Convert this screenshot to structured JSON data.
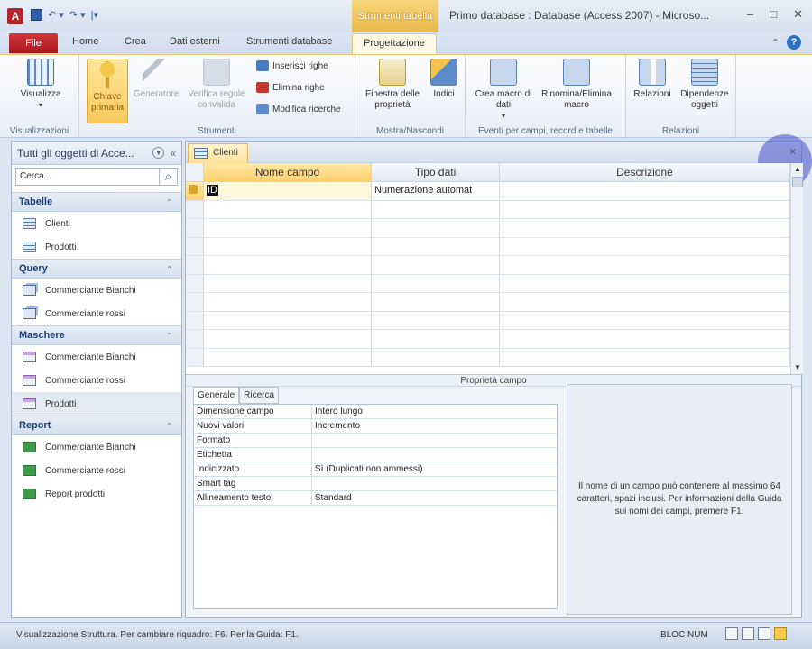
{
  "titlebar": {
    "app_icon": "A",
    "context_tab_header": "Strumenti tabella",
    "window_title": "Primo database : Database (Access 2007) - Microso...",
    "minimize": "–",
    "maximize": "□",
    "close": "✕"
  },
  "tabs": {
    "file": "File",
    "home": "Home",
    "crea": "Crea",
    "dati_esterni": "Dati esterni",
    "strumenti_database": "Strumenti database",
    "progettazione": "Progettazione"
  },
  "ribbon": {
    "visualizza": "Visualizza",
    "chiave_primaria": "Chiave primaria",
    "generatore": "Generatore",
    "verifica_regole": "Verifica regole convalida",
    "inserisci_righe": "Inserisci righe",
    "elimina_righe": "Elimina righe",
    "modifica_ricerche": "Modifica ricerche",
    "finestra_proprieta": "Finestra delle proprietà",
    "indici": "Indici",
    "crea_macro": "Crea macro di dati",
    "rinomina_macro": "Rinomina/Elimina macro",
    "relazioni": "Relazioni",
    "dipendenze": "Dipendenze oggetti",
    "group_visualizzazioni": "Visualizzazioni",
    "group_strumenti": "Strumenti",
    "group_mostra": "Mostra/Nascondi",
    "group_eventi": "Eventi per campi, record e tabelle",
    "group_relazioni": "Relazioni"
  },
  "nav": {
    "title": "Tutti gli oggetti di Acce...",
    "search_placeholder": "Cerca...",
    "sections": [
      {
        "label": "Tabelle",
        "items": [
          "Clienti",
          "Prodotti"
        ]
      },
      {
        "label": "Query",
        "items": [
          "Commerciante Bianchi",
          "Commerciante rossi"
        ]
      },
      {
        "label": "Maschere",
        "items": [
          "Commerciante Bianchi",
          "Commerciante rossi",
          "Prodotti"
        ]
      },
      {
        "label": "Report",
        "items": [
          "Commerciante Bianchi",
          "Commerciante rossi",
          "Report prodotti"
        ]
      }
    ]
  },
  "document": {
    "tab_label": "Clienti",
    "close": "×",
    "columns": [
      "Nome campo",
      "Tipo dati",
      "Descrizione"
    ],
    "first_row": {
      "name": "ID",
      "type": "Numerazione automat",
      "desc": ""
    },
    "properties_label": "Proprietà campo",
    "prop_tabs": [
      "Generale",
      "Ricerca"
    ],
    "properties": [
      {
        "k": "Dimensione campo",
        "v": "Intero lungo"
      },
      {
        "k": "Nuovi valori",
        "v": "Incremento"
      },
      {
        "k": "Formato",
        "v": ""
      },
      {
        "k": "Etichetta",
        "v": ""
      },
      {
        "k": "Indicizzato",
        "v": "Sì (Duplicati non ammessi)"
      },
      {
        "k": "Smart tag",
        "v": ""
      },
      {
        "k": "Allineamento testo",
        "v": "Standard"
      }
    ],
    "help_text": "Il nome di un campo può contenere al massimo 64 caratteri, spazi inclusi. Per informazioni della Guida sui nomi dei campi, premere F1."
  },
  "status": {
    "text": "Visualizzazione Struttura. Per cambiare riquadro: F6. Per la Guida: F1.",
    "num_lock": "BLOC NUM"
  }
}
